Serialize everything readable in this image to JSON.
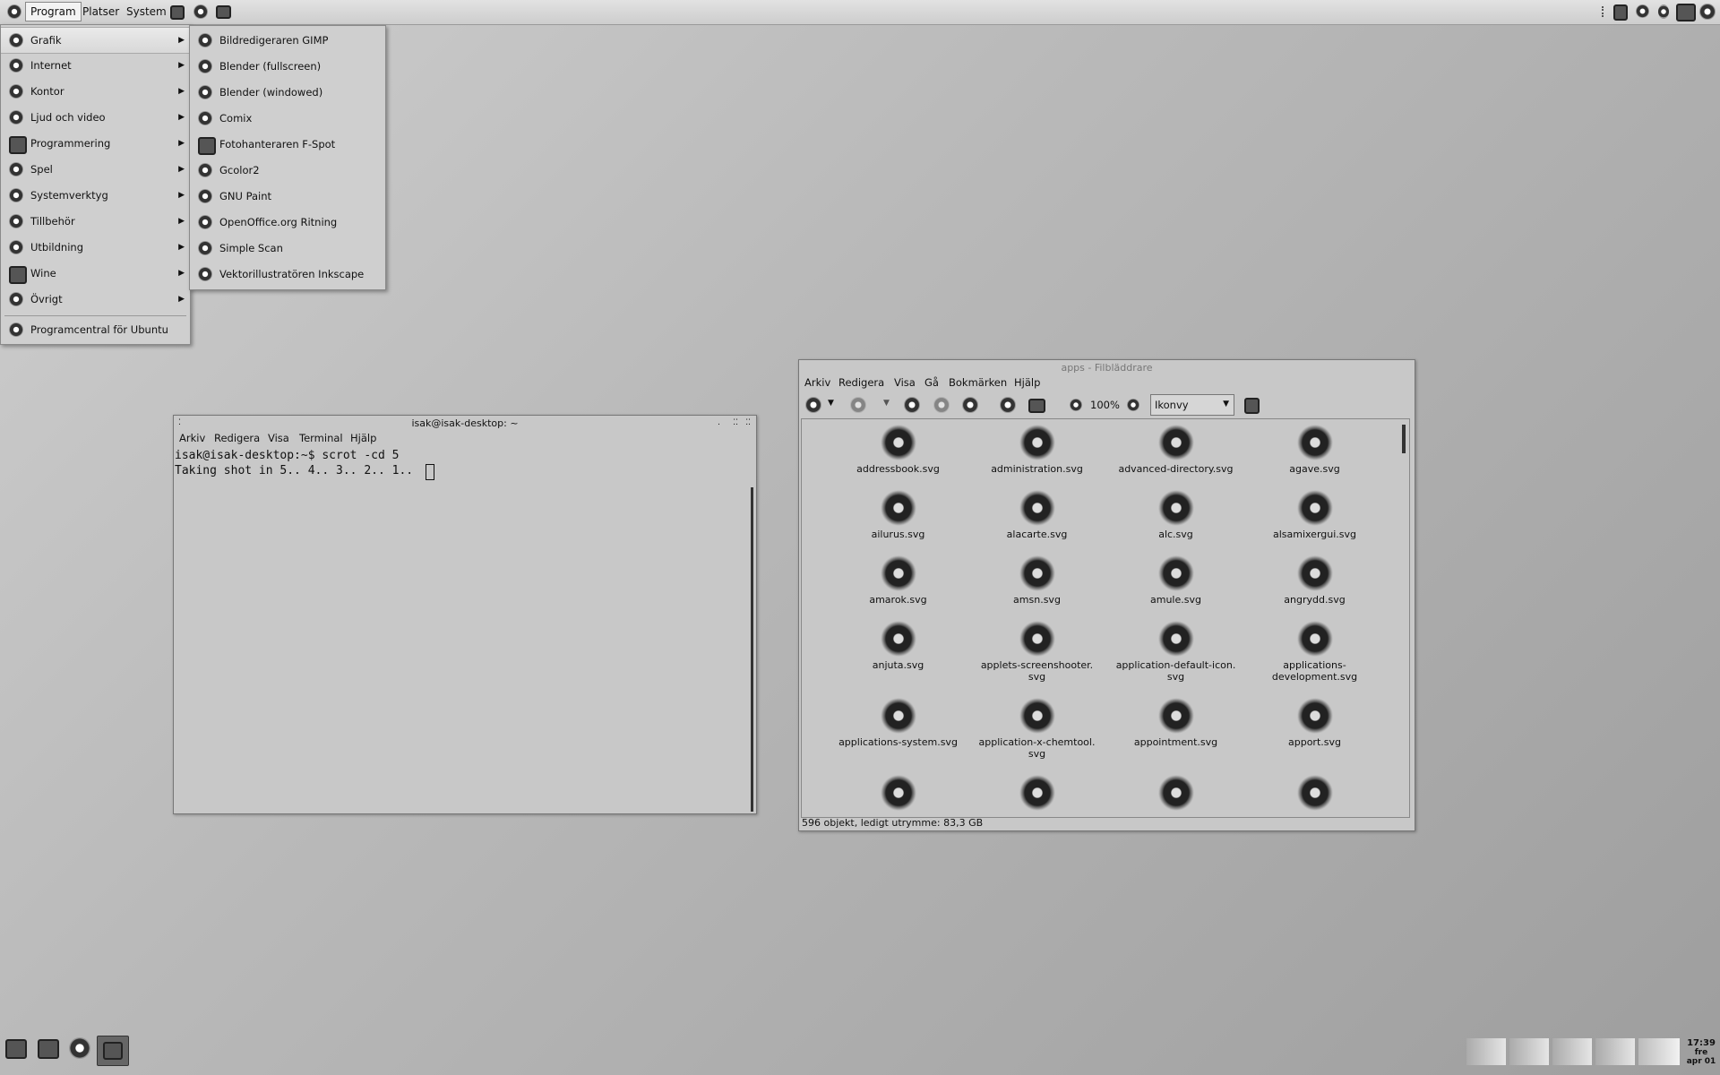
{
  "top_panel": {
    "menus": [
      "Program",
      "Platser",
      "System"
    ]
  },
  "program_menu": {
    "items": [
      {
        "label": "Grafik",
        "icon": "graphics-icon",
        "submenu": true
      },
      {
        "label": "Internet",
        "icon": "globe-icon",
        "submenu": true
      },
      {
        "label": "Kontor",
        "icon": "office-icon",
        "submenu": true
      },
      {
        "label": "Ljud och video",
        "icon": "media-icon",
        "submenu": true
      },
      {
        "label": "Programmering",
        "icon": "programming-icon",
        "submenu": true
      },
      {
        "label": "Spel",
        "icon": "games-icon",
        "submenu": true
      },
      {
        "label": "Systemverktyg",
        "icon": "system-tools-icon",
        "submenu": true
      },
      {
        "label": "Tillbehör",
        "icon": "accessories-icon",
        "submenu": true
      },
      {
        "label": "Utbildning",
        "icon": "education-icon",
        "submenu": true
      },
      {
        "label": "Wine",
        "icon": "wine-icon",
        "submenu": true
      },
      {
        "label": "Övrigt",
        "icon": "other-icon",
        "submenu": true
      }
    ],
    "footer": "Programcentral för Ubuntu"
  },
  "grafik_submenu": {
    "items": [
      "Bildredigeraren GIMP",
      "Blender (fullscreen)",
      "Blender (windowed)",
      "Comix",
      "Fotohanteraren F-Spot",
      "Gcolor2",
      "GNU Paint",
      "OpenOffice.org Ritning",
      "Simple Scan",
      "Vektorillustratören Inkscape"
    ]
  },
  "terminal": {
    "title": "isak@isak-desktop: ~",
    "menu": [
      "Arkiv",
      "Redigera",
      "Visa",
      "Terminal",
      "Hjälp"
    ],
    "lines": [
      "isak@isak-desktop:~$ scrot -cd 5",
      "Taking shot in 5.. 4.. 3.. 2.. 1.. "
    ]
  },
  "file_browser": {
    "title": "apps - Filbläddrare",
    "menu": [
      "Arkiv",
      "Redigera",
      "Visa",
      "Gå",
      "Bokmärken",
      "Hjälp"
    ],
    "zoom": "100%",
    "view_mode": "Ikonvy",
    "files": [
      "addressbook.svg",
      "administration.svg",
      "advanced-directory.svg",
      "agave.svg",
      "ailurus.svg",
      "alacarte.svg",
      "alc.svg",
      "alsamixergui.svg",
      "amarok.svg",
      "amsn.svg",
      "amule.svg",
      "angrydd.svg",
      "anjuta.svg",
      "applets-screenshooter.\nsvg",
      "application-default-icon.\nsvg",
      "applications-\ndevelopment.svg",
      "applications-system.svg",
      "application-x-chemtool.\nsvg",
      "appointment.svg",
      "apport.svg",
      "",
      "",
      "",
      ""
    ],
    "status": "596 objekt, ledigt utrymme: 83,3 GB"
  },
  "clock": {
    "time": "17:39",
    "day": "fre",
    "date": "apr 01"
  }
}
